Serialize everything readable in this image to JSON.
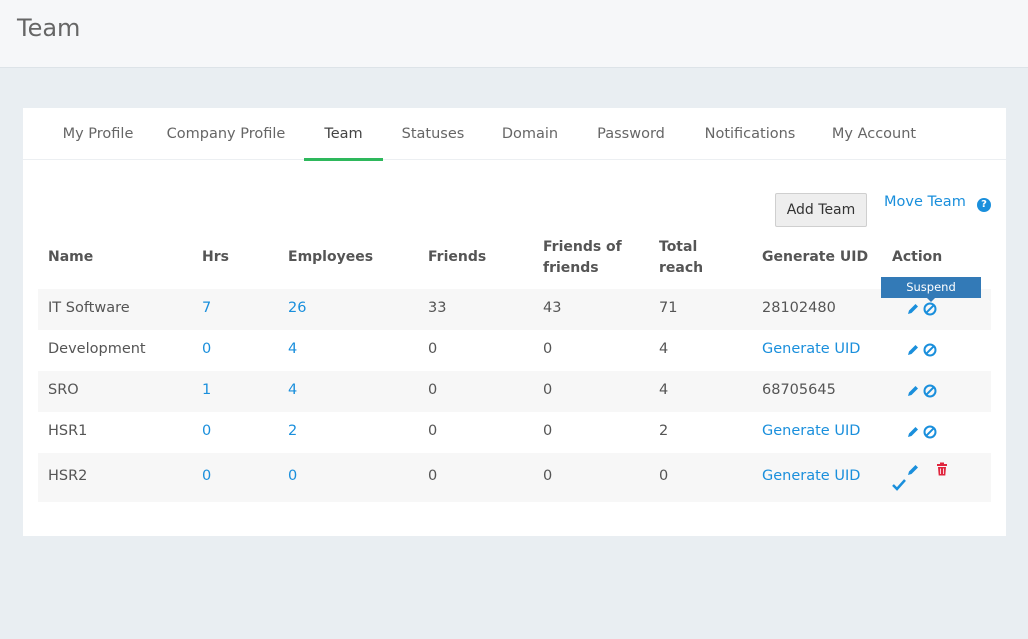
{
  "page": {
    "title": "Team"
  },
  "tabs": [
    "My Profile",
    "Company Profile",
    "Team",
    "Statuses",
    "Domain",
    "Password",
    "Notifications",
    "My Account"
  ],
  "active_tab": "Team",
  "toolbar": {
    "add_team": "Add Team",
    "move_team": "Move Team",
    "help": "?"
  },
  "table": {
    "headers": {
      "name": "Name",
      "hrs": "Hrs",
      "employees": "Employees",
      "friends": "Friends",
      "fof_1": "Friends of",
      "fof_2": "friends",
      "reach_1": "Total",
      "reach_2": "reach",
      "uid": "Generate UID",
      "action": "Action"
    },
    "rows": [
      {
        "name": "IT Software",
        "hrs": "7",
        "employees": "26",
        "friends": "33",
        "fof": "43",
        "reach": "71",
        "uid": "28102480"
      },
      {
        "name": "Development",
        "hrs": "0",
        "employees": "4",
        "friends": "0",
        "fof": "0",
        "reach": "4",
        "uid": "Generate UID"
      },
      {
        "name": "SRO",
        "hrs": "1",
        "employees": "4",
        "friends": "0",
        "fof": "0",
        "reach": "4",
        "uid": "68705645"
      },
      {
        "name": "HSR1",
        "hrs": "0",
        "employees": "2",
        "friends": "0",
        "fof": "0",
        "reach": "2",
        "uid": "Generate UID"
      },
      {
        "name": "HSR2",
        "hrs": "0",
        "employees": "0",
        "friends": "0",
        "fof": "0",
        "reach": "0",
        "uid": "Generate UID"
      }
    ]
  },
  "tooltip": "Suspend",
  "colors": {
    "accent": "#1a8fdc",
    "active_tab": "#2eb85c",
    "delete": "#e0263e",
    "tooltip": "#337ab7"
  }
}
